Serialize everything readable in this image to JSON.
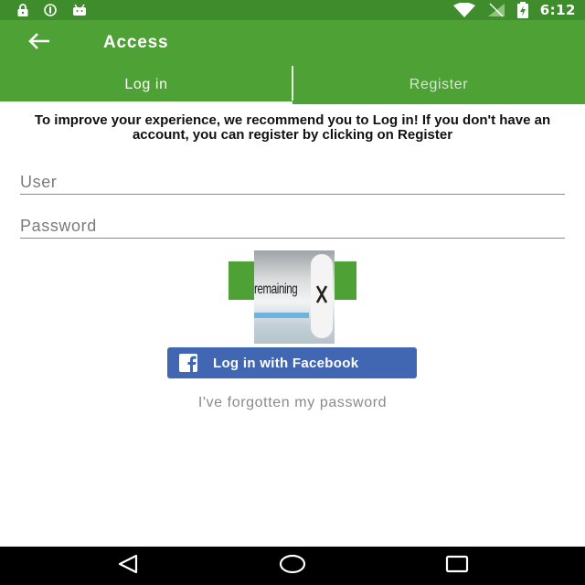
{
  "status_bar": {
    "time": "6:12",
    "icons": [
      "lock-icon",
      "data-saver-icon",
      "android-icon",
      "wifi-icon",
      "signal-icon",
      "battery-charging-icon"
    ]
  },
  "app_bar": {
    "title": "Access",
    "back_icon": "arrow-left-icon"
  },
  "tabs": [
    {
      "label": "Log in",
      "active": true
    },
    {
      "label": "Register",
      "active": false
    }
  ],
  "intro_text": "To improve your experience, we recommend you to Log in! If you don't have an account, you can register by clicking on Register",
  "form": {
    "user_placeholder": "User",
    "user_value": "",
    "password_placeholder": "Password",
    "password_value": ""
  },
  "ad": {
    "text": "remaining",
    "close_icon": "close-icon"
  },
  "facebook_button": {
    "label": "Log in with Facebook",
    "icon": "facebook-icon"
  },
  "forgot_password": "I've forgotten my password",
  "colors": {
    "primary": "#4ea135",
    "primary_dark": "#3f8c2c",
    "facebook": "#4267b2"
  },
  "nav_bar": {
    "icons": [
      "back-triangle-icon",
      "home-circle-icon",
      "recents-square-icon"
    ]
  }
}
